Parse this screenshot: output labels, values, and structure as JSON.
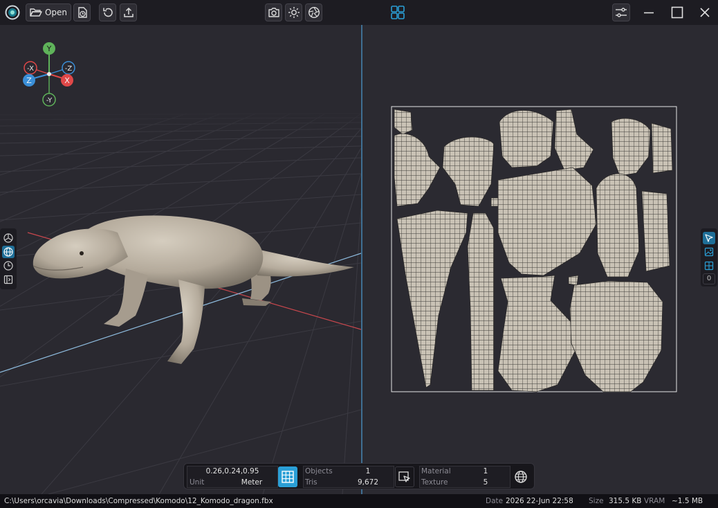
{
  "toolbar": {
    "open_label": "Open"
  },
  "gizmo": {
    "y": "Y",
    "neg_x": "-X",
    "neg_z": "-Z",
    "z": "Z",
    "x": "X",
    "neg_y": "-Y"
  },
  "info_panel": {
    "coords": "0.26,0.24,0.95",
    "unit_label": "Unit",
    "unit_value": "Meter",
    "objects_label": "Objects",
    "objects_value": "1",
    "tris_label": "Tris",
    "tris_value": "9,672",
    "material_label": "Material",
    "material_value": "1",
    "texture_label": "Texture",
    "texture_value": "5"
  },
  "right_toolbar": {
    "count": "0"
  },
  "status": {
    "path": "C:\\Users\\orcavia\\Downloads\\Compressed\\Komodo\\12_Komodo_dragon.fbx",
    "date_label": "Date",
    "date_value": "2026 22-Jun 22:58",
    "size_label": "Size",
    "size_value": "315.5 KB",
    "vram_label": "VRAM",
    "vram_value": "~1.5 MB"
  },
  "colors": {
    "accent": "#2a9fd6",
    "axis_x": "#e04848",
    "axis_y": "#4caf50",
    "axis_z": "#3a8fd8"
  }
}
